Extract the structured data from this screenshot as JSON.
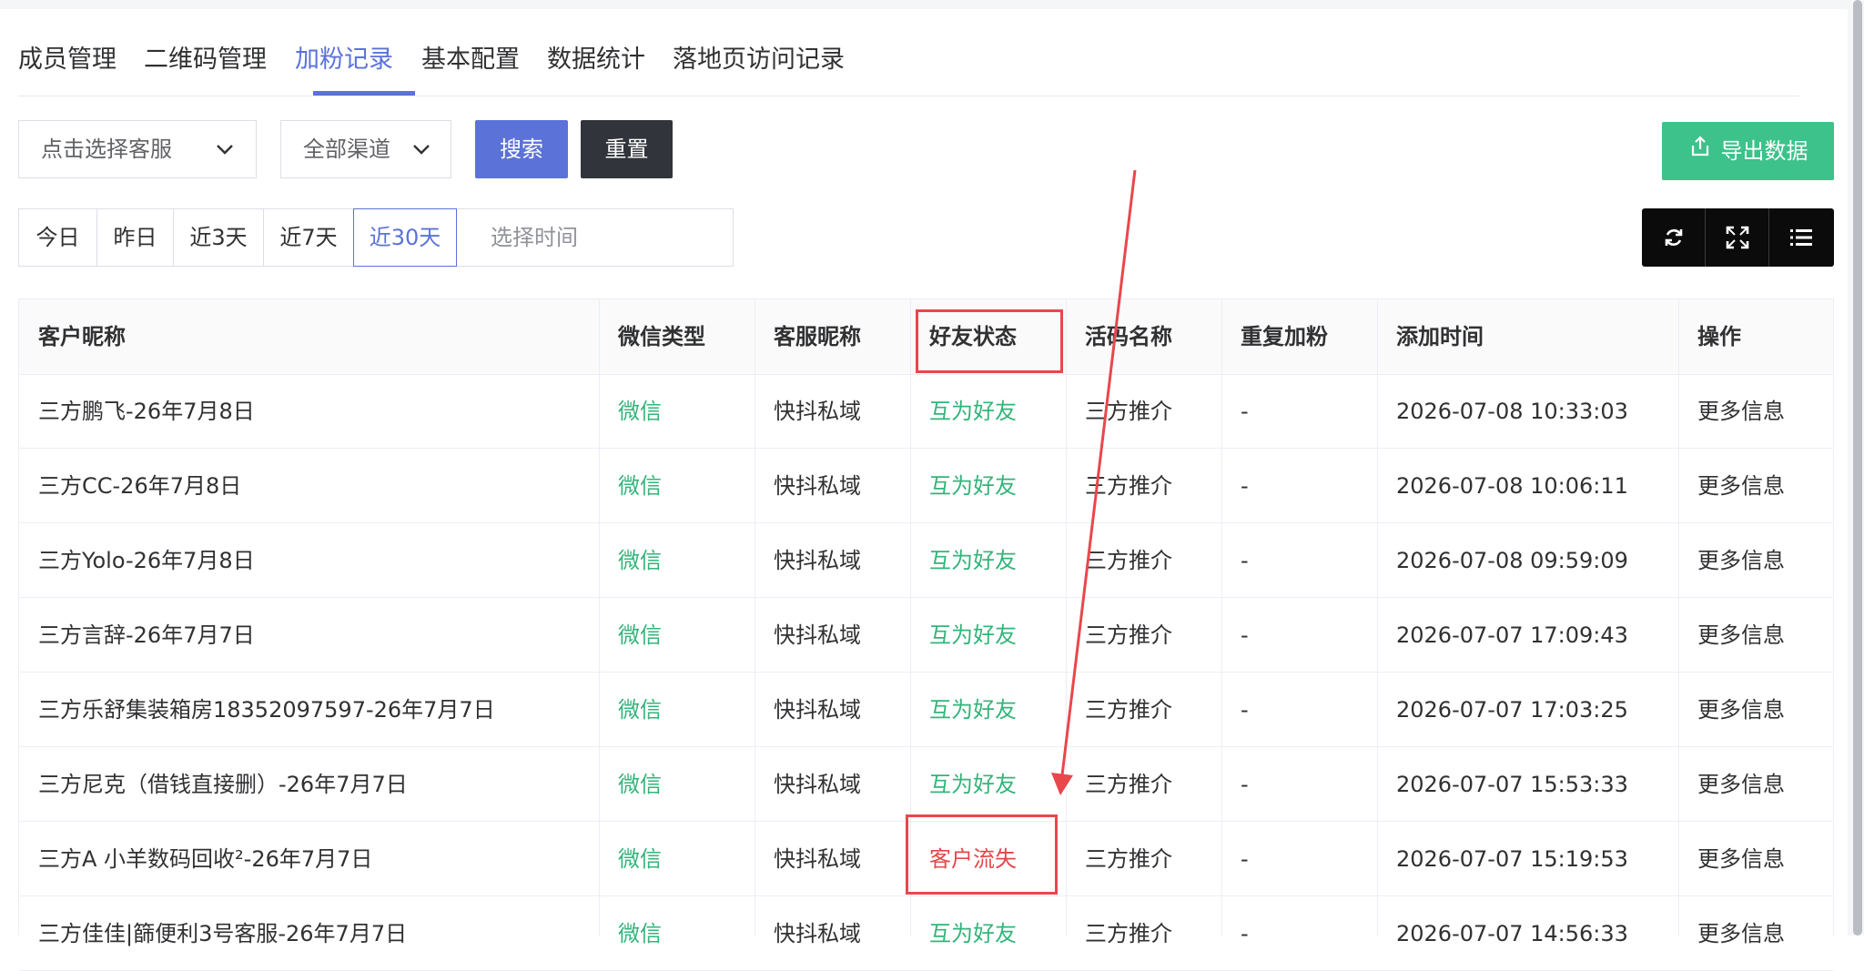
{
  "tabs": [
    {
      "label": "成员管理",
      "active": false
    },
    {
      "label": "二维码管理",
      "active": false
    },
    {
      "label": "加粉记录",
      "active": true
    },
    {
      "label": "基本配置",
      "active": false
    },
    {
      "label": "数据统计",
      "active": false
    },
    {
      "label": "落地页访问记录",
      "active": false
    }
  ],
  "filters": {
    "service_select": "点击选择客服",
    "channel_select": "全部渠道",
    "search_label": "搜索",
    "reset_label": "重置",
    "export_label": "导出数据"
  },
  "date_range": {
    "options": [
      "今日",
      "昨日",
      "近3天",
      "近7天",
      "近30天"
    ],
    "active": "近30天",
    "placeholder": "选择时间"
  },
  "toolbar_icons": [
    "refresh-icon",
    "fullscreen-icon",
    "column-list-icon"
  ],
  "table": {
    "headers": [
      "客户昵称",
      "微信类型",
      "客服昵称",
      "好友状态",
      "活码名称",
      "重复加粉",
      "添加时间",
      "操作"
    ],
    "rows": [
      [
        "三方鹏飞-26年7月8日",
        "微信",
        "快抖私域",
        "互为好友",
        "三方推介",
        "-",
        "2026-07-08 10:33:03",
        "更多信息"
      ],
      [
        "三方CC-26年7月8日",
        "微信",
        "快抖私域",
        "互为好友",
        "三方推介",
        "-",
        "2026-07-08 10:06:11",
        "更多信息"
      ],
      [
        "三方Yolo-26年7月8日",
        "微信",
        "快抖私域",
        "互为好友",
        "三方推介",
        "-",
        "2026-07-08 09:59:09",
        "更多信息"
      ],
      [
        "三方言辞-26年7月7日",
        "微信",
        "快抖私域",
        "互为好友",
        "三方推介",
        "-",
        "2026-07-07 17:09:43",
        "更多信息"
      ],
      [
        "三方乐舒集装箱房18352097597-26年7月7日",
        "微信",
        "快抖私域",
        "互为好友",
        "三方推介",
        "-",
        "2026-07-07 17:03:25",
        "更多信息"
      ],
      [
        "三方尼克（借钱直接删）-26年7月7日",
        "微信",
        "快抖私域",
        "互为好友",
        "三方推介",
        "-",
        "2026-07-07 15:53:33",
        "更多信息"
      ],
      [
        "三方A 小羊数码回收²-26年7月7日",
        "微信",
        "快抖私域",
        "客户流失",
        "三方推介",
        "-",
        "2026-07-07 15:19:53",
        "更多信息"
      ],
      [
        "三方佳佳|篩便利3号客服-26年7月7日",
        "微信",
        "快抖私域",
        "互为好友",
        "三方推介",
        "-",
        "2026-07-07 14:56:33",
        "更多信息"
      ]
    ]
  },
  "colors": {
    "accent": "#5b72d8",
    "friend_green": "#33b47a",
    "lost_red": "#e4474b",
    "export_green": "#3cc28a",
    "annotation_red": "#e8474c"
  }
}
